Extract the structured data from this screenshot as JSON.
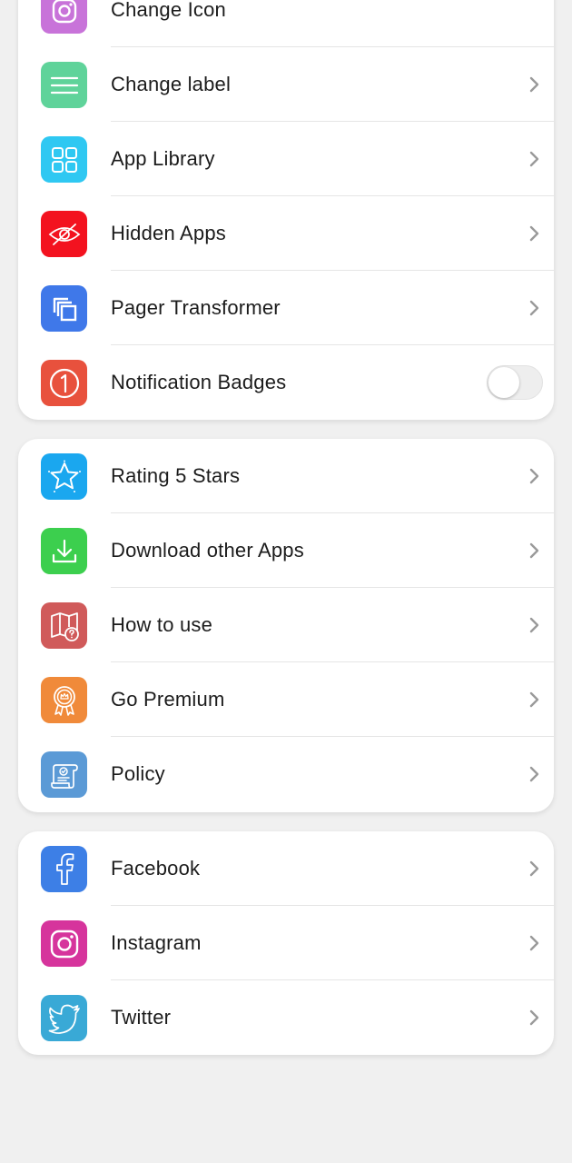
{
  "colors": {
    "background": "#f0f0f0",
    "card": "#ffffff",
    "divider": "#e5e5e5",
    "text": "#1c1c1c",
    "chevron": "#9a9a9a"
  },
  "sections": [
    {
      "items": [
        {
          "label": "Change Icon",
          "icon": "instagram-like-icon",
          "color": "#c873d9",
          "control": "chevron"
        },
        {
          "label": "Change label",
          "icon": "menu-lines-icon",
          "color": "#5fd39a",
          "control": "chevron"
        },
        {
          "label": "App Library",
          "icon": "grid-icon",
          "color": "#2fc8f2",
          "control": "chevron"
        },
        {
          "label": "Hidden Apps",
          "icon": "eye-off-icon",
          "color": "#f3121f",
          "control": "chevron"
        },
        {
          "label": "Pager Transformer",
          "icon": "copy-icon",
          "color": "#3f78e9",
          "control": "chevron"
        },
        {
          "label": "Notification Badges",
          "icon": "badge-one-icon",
          "color": "#e8513d",
          "control": "toggle",
          "enabled": false
        }
      ]
    },
    {
      "items": [
        {
          "label": "Rating 5 Stars",
          "icon": "star-icon",
          "color": "#1aa7ef",
          "control": "chevron"
        },
        {
          "label": "Download other Apps",
          "icon": "download-icon",
          "color": "#3ccf4e",
          "control": "chevron"
        },
        {
          "label": "How to use",
          "icon": "book-question-icon",
          "color": "#d05a5a",
          "control": "chevron"
        },
        {
          "label": "Go Premium",
          "icon": "premium-badge-icon",
          "color": "#f08a3a",
          "control": "chevron"
        },
        {
          "label": "Policy",
          "icon": "scroll-icon",
          "color": "#5b9ad6",
          "control": "chevron"
        }
      ]
    },
    {
      "items": [
        {
          "label": "Facebook",
          "icon": "facebook-icon",
          "color": "#3d7fe6",
          "control": "chevron"
        },
        {
          "label": "Instagram",
          "icon": "instagram-icon",
          "color": "#d6349c",
          "control": "chevron"
        },
        {
          "label": "Twitter",
          "icon": "twitter-icon",
          "color": "#39a9d6",
          "control": "chevron"
        }
      ]
    }
  ]
}
